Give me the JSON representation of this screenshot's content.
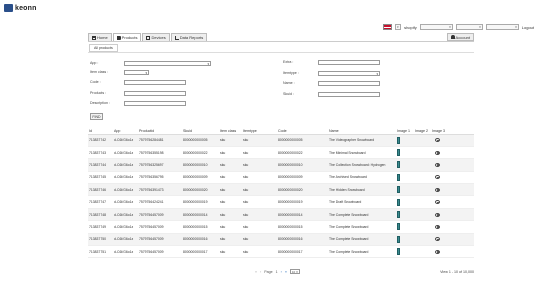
{
  "brand": {
    "name": "keonn"
  },
  "topbar": {
    "store_label": "shopify",
    "select_placeholders": [
      "",
      "",
      "",
      ""
    ],
    "logout": "Logout"
  },
  "nav": {
    "tabs": [
      {
        "label": "Home",
        "icon": "home-icon"
      },
      {
        "label": "Products",
        "icon": "tag-icon"
      },
      {
        "label": "Devices",
        "icon": "monitor-icon"
      },
      {
        "label": "Data Reports",
        "icon": "chart-icon"
      }
    ],
    "account": "Account"
  },
  "subtab": {
    "label": "All products"
  },
  "filters": {
    "app": "App :",
    "item_class": "Item class :",
    "code": "Code :",
    "products": "Products :",
    "description": "Description :",
    "extra": "Extra :",
    "itemtype": "Itemtype :",
    "name": "Name :",
    "skuid": "Skuid :"
  },
  "find": "FIND",
  "table": {
    "headers": [
      "Id",
      "App",
      "Productid",
      "Skuid",
      "Item class",
      "Itemtype",
      "Code",
      "Name",
      "Image 1",
      "Image 2",
      "Image 3"
    ],
    "rows": [
      [
        "713837742",
        "d-C6I/G6o1z",
        "7579756284481",
        "8000000000005",
        "sku",
        "sku",
        "8000000000005",
        "The Videographer Snowboard"
      ],
      [
        "713837743",
        "d-C6I/G6o1z",
        "7579756355198",
        "8000000000022",
        "sku",
        "sku",
        "8000000000022",
        "The Minimal Snowboard"
      ],
      [
        "713837744",
        "d-C6I/G6o1z",
        "7579756325697",
        "8000000000010",
        "sku",
        "sku",
        "8000000000010",
        "The Collection Snowboard: Hydrogen"
      ],
      [
        "713837745",
        "d-C6I/G6o1z",
        "7579756356795",
        "8000000000009",
        "sku",
        "sku",
        "8000000000009",
        "The Archived Snowboard"
      ],
      [
        "713837746",
        "d-C6I/G6o1z",
        "7579756391473",
        "8000000000020",
        "sku",
        "sku",
        "8000000000020",
        "The Hidden Snowboard"
      ],
      [
        "713837747",
        "d-C6I/G6o1z",
        "7579756424241",
        "8000000000019",
        "sku",
        "sku",
        "8000000000019",
        "The Draft Snowboard"
      ],
      [
        "713837748",
        "d-C6I/G6o1z",
        "7579756457009",
        "8000000000014",
        "sku",
        "sku",
        "8000000000014",
        "The Complete Snowboard"
      ],
      [
        "713837749",
        "d-C6I/G6o1z",
        "7579756457009",
        "8000000000015",
        "sku",
        "sku",
        "8000000000015",
        "The Complete Snowboard"
      ],
      [
        "713837750",
        "d-C6I/G6o1z",
        "7579756457009",
        "8000000000016",
        "sku",
        "sku",
        "8000000000016",
        "The Complete Snowboard"
      ],
      [
        "713837751",
        "d-C6I/G6o1z",
        "7579756457009",
        "8000000000017",
        "sku",
        "sku",
        "8000000000017",
        "The Complete Snowboard"
      ]
    ]
  },
  "pager": {
    "first": "«",
    "prev": "‹",
    "page_label": "Page",
    "current": "1",
    "next": "›",
    "last": "»",
    "page_size": "10",
    "info": "View 1 - 10 of 10,000"
  },
  "colors": {
    "thumb": "#3a8a8f",
    "logo": "#2a4f8a"
  }
}
